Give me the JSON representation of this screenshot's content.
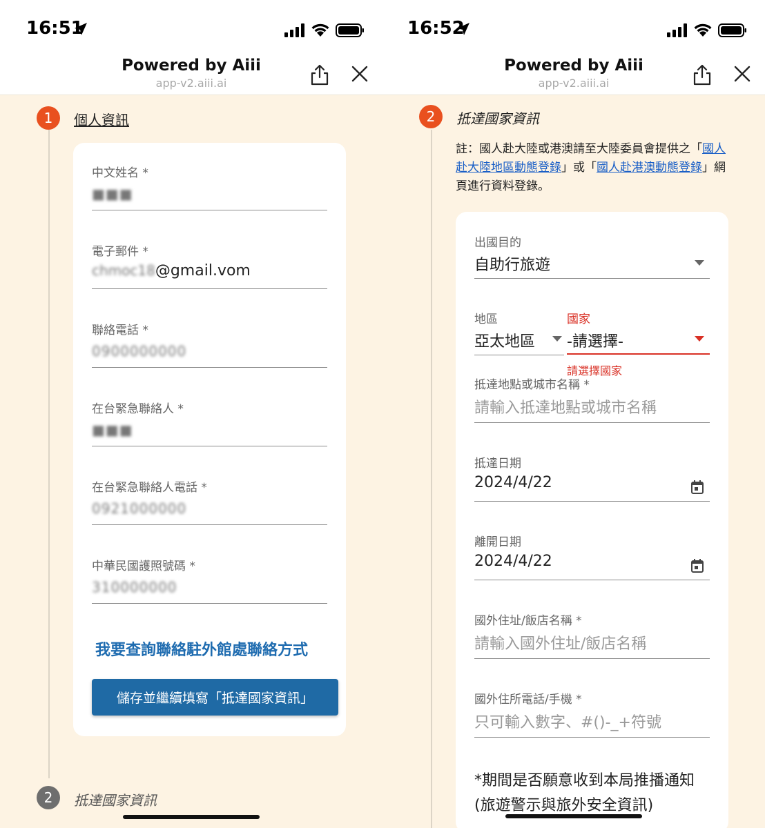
{
  "left": {
    "status_time": "16:51",
    "browser_title": "Powered by Aiii",
    "browser_url": "app-v2.aiii.ai",
    "step1": {
      "number": "1",
      "title": "個人資訊"
    },
    "fields": {
      "chinese_name": {
        "label": "中文姓名 *",
        "value": "■■■"
      },
      "email": {
        "label": "電子郵件 *",
        "value_hidden": "chmoc18",
        "value_visible": "@gmail.vom"
      },
      "phone": {
        "label": "聯絡電話 *",
        "value": "0900000000"
      },
      "emergency_contact": {
        "label": "在台緊急聯絡人 *",
        "value": "■■■"
      },
      "emergency_phone": {
        "label": "在台緊急聯絡人電話 *",
        "value": "0921000000"
      },
      "passport": {
        "label": "中華民國護照號碼 *",
        "value": "310000000"
      }
    },
    "consulate_link": "我要查詢聯絡駐外館處聯絡方式",
    "save_button": "儲存並繼續填寫「抵達國家資訊」",
    "step2": {
      "number": "2",
      "title": "抵達國家資訊"
    }
  },
  "right": {
    "status_time": "16:52",
    "browser_title": "Powered by Aiii",
    "browser_url": "app-v2.aiii.ai",
    "step2": {
      "number": "2",
      "title": "抵達國家資訊"
    },
    "note": {
      "prefix": "註：國人赴大陸或港澳請至大陸委員會提供之「",
      "link1": "國人赴大陸地區動態登錄",
      "middle": "」或「",
      "link2": "國人赴港澳動態登錄",
      "suffix": "」網頁進行資料登錄。"
    },
    "fields": {
      "purpose": {
        "label": "出國目的",
        "value": "自助行旅遊"
      },
      "region": {
        "label": "地區",
        "value": "亞太地區"
      },
      "country": {
        "label": "國家",
        "value": "-請選擇-",
        "error": "請選擇國家"
      },
      "city": {
        "label": "抵達地點或城市名稱 *",
        "placeholder": "請輸入抵達地點或城市名稱"
      },
      "arrival_date": {
        "label": "抵達日期",
        "value": "2024/4/22"
      },
      "departure_date": {
        "label": "離開日期",
        "value": "2024/4/22"
      },
      "address": {
        "label": "國外住址/飯店名稱 *",
        "placeholder": "請輸入國外住址/飯店名稱"
      },
      "overseas_phone": {
        "label": "國外住所電話/手機 *",
        "placeholder": "只可輸入數字、#()-_+符號"
      }
    },
    "notification_question_line1": "*期間是否願意收到本局推播通知",
    "notification_question_line2": "(旅遊警示與旅外安全資訊)"
  },
  "colors": {
    "accent": "#e9501f",
    "primary_button": "#1f6aa5",
    "link": "#1f6cb0",
    "error": "#d93025",
    "page_background": "#fdf3e3"
  },
  "icons": [
    "location-arrow-icon",
    "signal-icon",
    "wifi-icon",
    "battery-icon",
    "share-icon",
    "close-icon",
    "dropdown-icon",
    "calendar-icon"
  ]
}
